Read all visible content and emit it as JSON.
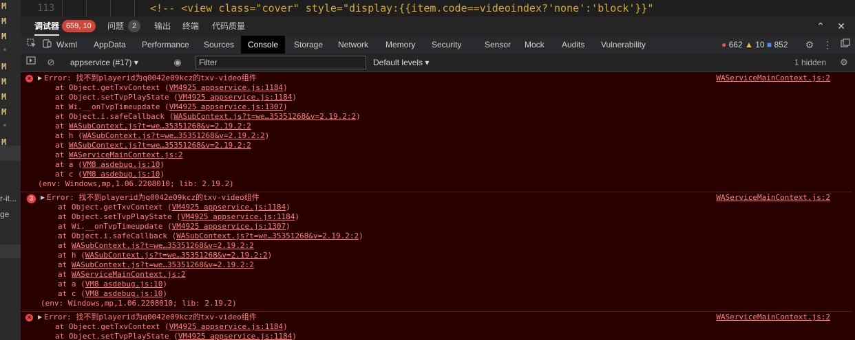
{
  "editor": {
    "line_number": "113",
    "code": "<!-- <view class=\"cover\" style=\"display:{{item.code==videoindex?'none':'block'}}\""
  },
  "left_gutter": {
    "marks": [
      "M",
      "M",
      "M",
      "•",
      "M",
      "M",
      "M",
      "M",
      "•",
      "M"
    ],
    "stray_texts": [
      "r-it...",
      "ge"
    ]
  },
  "panel_tabs": {
    "items": [
      {
        "label": "调试器",
        "badge": "659, 10"
      },
      {
        "label": "问题",
        "badge": "2"
      },
      {
        "label": "输出"
      },
      {
        "label": "终端"
      },
      {
        "label": "代码质量"
      }
    ],
    "window_icons": [
      "chevron-up-icon",
      "close-icon"
    ]
  },
  "devtools_tabs": {
    "items": [
      "Wxml",
      "AppData",
      "Performance",
      "Sources",
      "Console",
      "Storage",
      "Network",
      "Memory",
      "Security",
      "Sensor",
      "Mock",
      "Audits",
      "Vulnerability"
    ],
    "active": "Console",
    "counts": {
      "errors": "662",
      "warnings": "10",
      "info": "852"
    },
    "colors": {
      "error": "#e05555",
      "warning": "#f0c040",
      "info": "#4a90e2"
    }
  },
  "console_toolbar": {
    "context": "appservice (#17)",
    "filter_placeholder": "Filter",
    "levels": "Default levels",
    "hidden": "1 hidden"
  },
  "log_entries": [
    {
      "repeat": "",
      "message": "Error: 找不到playerid为q0042e09kcz的txv-video组件",
      "source": "WAServiceMainContext.js:2",
      "frames": [
        [
          "at Object.getTxvContext (",
          "VM4925 appservice.js:1184",
          ")"
        ],
        [
          "at Object.setTvpPlayState (",
          "VM4925 appservice.js:1184",
          ")"
        ],
        [
          "at Wi.__onTvpTimeupdate (",
          "VM4925 appservice.js:1307",
          ")"
        ],
        [
          "at Object.i.safeCallback (",
          "WASubContext.js?t=we…35351268&v=2.19.2:2",
          ")"
        ],
        [
          "at ",
          "WASubContext.js?t=we…35351268&v=2.19.2:2",
          ""
        ],
        [
          "at h (",
          "WASubContext.js?t=we…35351268&v=2.19.2:2",
          ")"
        ],
        [
          "at ",
          "WASubContext.js?t=we…35351268&v=2.19.2:2",
          ""
        ],
        [
          "at ",
          "WAServiceMainContext.js:2",
          ""
        ],
        [
          "at a (",
          "VM8 asdebug.js:10",
          ")"
        ],
        [
          "at c (",
          "VM8 asdebug.js:10",
          ")"
        ]
      ],
      "env": "(env: Windows,mp,1.06.2208010; lib: 2.19.2)"
    },
    {
      "repeat": "3",
      "message": "Error: 找不到playerid为q0042e09kcz的txv-video组件",
      "source": "WAServiceMainContext.js:2",
      "frames": [
        [
          "at Object.getTxvContext (",
          "VM4925 appservice.js:1184",
          ")"
        ],
        [
          "at Object.setTvpPlayState (",
          "VM4925 appservice.js:1184",
          ")"
        ],
        [
          "at Wi.__onTvpTimeupdate (",
          "VM4925 appservice.js:1307",
          ")"
        ],
        [
          "at Object.i.safeCallback (",
          "WASubContext.js?t=we…35351268&v=2.19.2:2",
          ")"
        ],
        [
          "at ",
          "WASubContext.js?t=we…35351268&v=2.19.2:2",
          ""
        ],
        [
          "at h (",
          "WASubContext.js?t=we…35351268&v=2.19.2:2",
          ")"
        ],
        [
          "at ",
          "WASubContext.js?t=we…35351268&v=2.19.2:2",
          ""
        ],
        [
          "at ",
          "WAServiceMainContext.js:2",
          ""
        ],
        [
          "at a (",
          "VM8 asdebug.js:10",
          ")"
        ],
        [
          "at c (",
          "VM8 asdebug.js:10",
          ")"
        ]
      ],
      "env": "(env: Windows,mp,1.06.2208010; lib: 2.19.2)"
    },
    {
      "repeat": "",
      "message": "Error: 找不到playerid为q0042e09kcz的txv-video组件",
      "source": "WAServiceMainContext.js:2",
      "frames": [
        [
          "at Object.getTxvContext (",
          "VM4925 appservice.js:1184",
          ")"
        ],
        [
          "at Object.setTvpPlayState (",
          "VM4925 appservice.js:1184",
          ")"
        ]
      ],
      "env": ""
    }
  ]
}
